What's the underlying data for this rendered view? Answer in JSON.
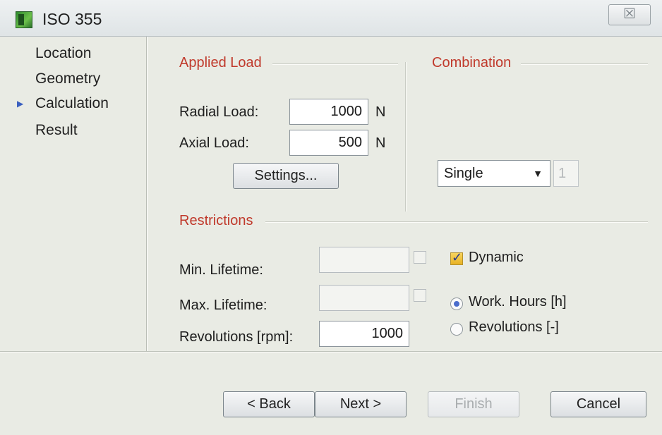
{
  "window": {
    "title": "ISO 355",
    "close_label": "☒"
  },
  "nav": {
    "items": [
      "Location",
      "Geometry",
      "Calculation",
      "Result"
    ],
    "active_index": 2,
    "active_marker": "▶"
  },
  "applied_load": {
    "title": "Applied Load",
    "radial_label": "Radial Load:",
    "radial_value": "1000",
    "radial_unit": "N",
    "axial_label": "Axial Load:",
    "axial_value": "500",
    "axial_unit": "N",
    "settings_label": "Settings..."
  },
  "combination": {
    "title": "Combination",
    "selected": "Single",
    "count_value": "1"
  },
  "restrictions": {
    "title": "Restrictions",
    "min_lifetime_label": "Min. Lifetime:",
    "min_lifetime_value": "",
    "min_lifetime_checked": false,
    "max_lifetime_label": "Max. Lifetime:",
    "max_lifetime_value": "",
    "max_lifetime_checked": false,
    "revolutions_label": "Revolutions [rpm]:",
    "revolutions_value": "1000",
    "dynamic_label": "Dynamic",
    "dynamic_checked": true,
    "work_hours_label": "Work. Hours [h]",
    "revolutions_option_label": "Revolutions [-]",
    "selected_mode": "Work. Hours [h]"
  },
  "footer": {
    "back_label": "< Back",
    "next_label": "Next >",
    "finish_label": "Finish",
    "cancel_label": "Cancel"
  },
  "colors": {
    "section_title": "#c0392b",
    "accent": "#4b6dcc",
    "background": "#e9ebe4"
  }
}
